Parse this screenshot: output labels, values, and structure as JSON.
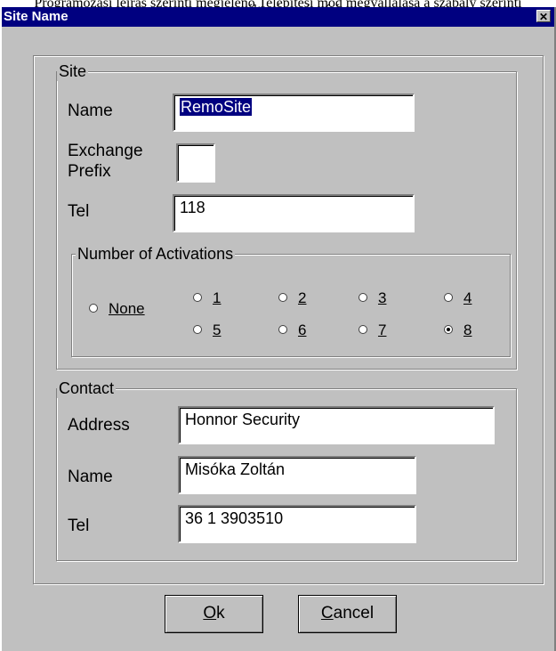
{
  "window": {
    "title": "Site Name",
    "close_glyph": "✕",
    "close_icon": "close-icon"
  },
  "page_caption": "Programozási leírás szerinti megjelenő Telepítési mód megvállalása a szabály szerinti megváltozás gyógyító",
  "site": {
    "caption": "Site",
    "name_label": "Name",
    "name_value": "RemoSite",
    "exchange_label_line1": "Exchange",
    "exchange_label_line2": "Prefix",
    "exchange_value": "",
    "tel_label": "Tel",
    "tel_value": "118"
  },
  "activations": {
    "caption": "Number of Activations",
    "selected": "8",
    "options": [
      {
        "label": "None",
        "selected": false
      },
      {
        "label": "1",
        "selected": false
      },
      {
        "label": "2",
        "selected": false
      },
      {
        "label": "3",
        "selected": false
      },
      {
        "label": "4",
        "selected": false
      },
      {
        "label": "5",
        "selected": false
      },
      {
        "label": "6",
        "selected": false
      },
      {
        "label": "7",
        "selected": false
      },
      {
        "label": "8",
        "selected": true
      }
    ]
  },
  "contact": {
    "caption": "Contact",
    "address_label": "Address",
    "address_value": "Honnor Security",
    "name_label": "Name",
    "name_value": "Misóka Zoltán",
    "tel_label": "Tel",
    "tel_value": "36 1 3903510"
  },
  "buttons": {
    "ok_mnemonic": "O",
    "ok_rest": "k",
    "cancel_mnemonic": "C",
    "cancel_rest": "ancel"
  },
  "colors": {
    "titlebar": "#000080",
    "face": "#c0c0c0",
    "selection": "#000080"
  }
}
